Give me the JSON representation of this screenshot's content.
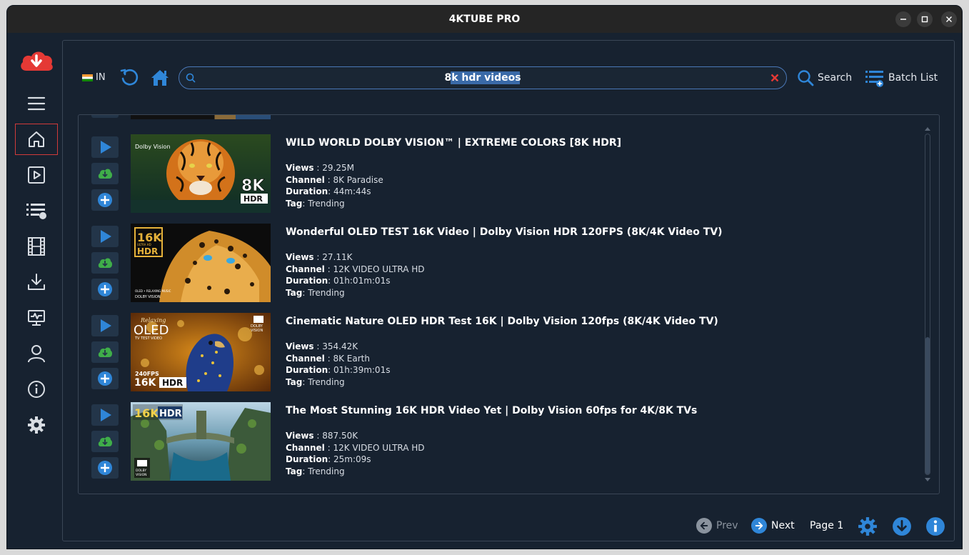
{
  "window": {
    "title": "4KTUBE PRO"
  },
  "sidebar": {
    "items": [
      {
        "name": "logo",
        "icon": "cloud-download-icon"
      },
      {
        "name": "menu",
        "icon": "hamburger-menu-icon"
      },
      {
        "name": "home",
        "icon": "home-icon",
        "active": true
      },
      {
        "name": "player",
        "icon": "play-square-icon"
      },
      {
        "name": "queue",
        "icon": "playlist-icon"
      },
      {
        "name": "media",
        "icon": "film-icon"
      },
      {
        "name": "downloads",
        "icon": "download-tray-icon"
      },
      {
        "name": "monitor",
        "icon": "monitor-pulse-icon"
      },
      {
        "name": "account",
        "icon": "user-icon"
      },
      {
        "name": "about",
        "icon": "info-circle-icon"
      },
      {
        "name": "settings",
        "icon": "gear-icon"
      }
    ],
    "accent": "#e53935"
  },
  "toolbar": {
    "country_code": "IN",
    "search_value": "8k hdr videos",
    "search_label": "Search",
    "batch_label": "Batch List"
  },
  "labels": {
    "views": "Views",
    "channel": "Channel",
    "duration": "Duration",
    "tag": "Tag"
  },
  "videos": [
    {
      "title": "WILD WORLD DOLBY VISION™ | EXTREME COLORS [8K HDR]",
      "views": "29.25M",
      "channel": "8K Paradise",
      "duration": "44m:44s",
      "tag": "Trending",
      "thumb_text": {
        "badge_top": "Dolby Vision",
        "badge_big": "8K",
        "badge_small": "HDR"
      }
    },
    {
      "title": "Wonderful OLED TEST 16K Video | Dolby Vision HDR 120FPS (8K/4K Video TV)",
      "views": "27.11K",
      "channel": "12K VIDEO ULTRA HD",
      "duration": "01h:01m:01s",
      "tag": "Trending",
      "thumb_text": {
        "badge_big": "16K",
        "badge_small": "HDR",
        "badge_sub": "ULTRA HD",
        "footer1": "OLED • RELAXING MUSIC",
        "footer2": "DOLBY VISION"
      }
    },
    {
      "title": "Cinematic Nature OLED HDR Test 16K | Dolby Vision 120fps (8K/4K Video TV)",
      "views": "354.42K",
      "channel": "8K Earth",
      "duration": "01h:39m:01s",
      "tag": "Trending",
      "thumb_text": {
        "script": "Relaxing",
        "big": "OLED",
        "sub": "TV TEST VIDEO",
        "fps": "240FPS",
        "badge_big": "16K",
        "badge_small": "HDR",
        "dolby": "DOLBY",
        "vision": "VISION"
      }
    },
    {
      "title": "The Most Stunning 16K HDR Video Yet | Dolby Vision 60fps for 4K/8K TVs",
      "views": "887.50K",
      "channel": "12K VIDEO ULTRA HD",
      "duration": "25m:09s",
      "tag": "Trending",
      "thumb_text": {
        "badge_big": "16K",
        "badge_small": "HDR",
        "dolby": "DOLBY",
        "vision": "VISION"
      }
    }
  ],
  "pager": {
    "prev_label": "Prev",
    "next_label": "Next",
    "page_label": "Page 1"
  },
  "colors": {
    "background": "#172230",
    "accent_blue": "#2f86d8",
    "download_green": "#3fae49",
    "clear_red": "#e53935"
  }
}
